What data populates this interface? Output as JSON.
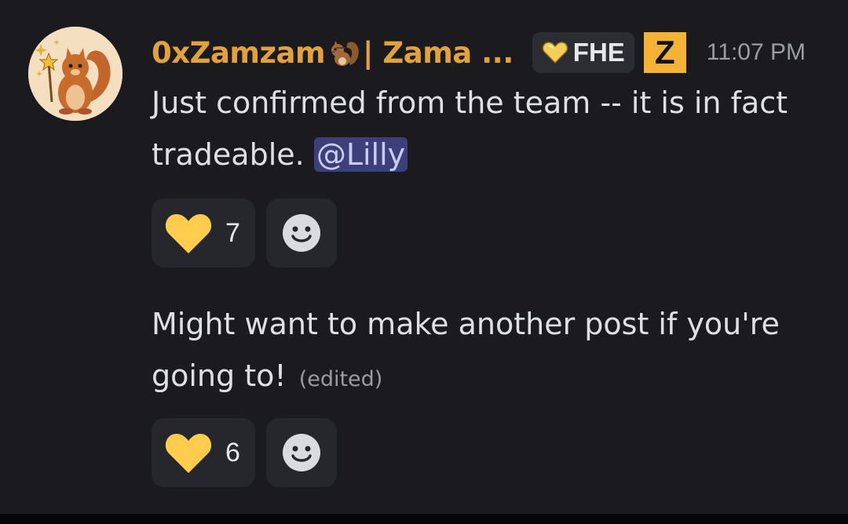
{
  "author": {
    "name_prefix": "0xZamzam",
    "name_suffix": "| Zama ...",
    "avatar_icon": "squirrel-wizard-avatar",
    "name_color": "#e1a23a"
  },
  "server_tag": {
    "label": "FHE",
    "icon": "gold-heart-icon"
  },
  "role_icon": {
    "letter": "Z",
    "color": "#f5b335"
  },
  "timestamp": "11:07 PM",
  "messages": [
    {
      "text_before": "Just confirmed from the team -- it is in fact tradeable. ",
      "mention": "@Lilly",
      "reactions": [
        {
          "emoji": "yellow-heart",
          "count": "7"
        }
      ]
    },
    {
      "text": "Might want to make another post if you're going to!",
      "edited_label": "(edited)",
      "reactions": [
        {
          "emoji": "yellow-heart",
          "count": "6"
        }
      ]
    }
  ],
  "colors": {
    "background": "#1b1b1f",
    "mention_bg": "#3c3f7a",
    "reaction_bg": "#26272c",
    "heart": "#ffcc4d"
  }
}
